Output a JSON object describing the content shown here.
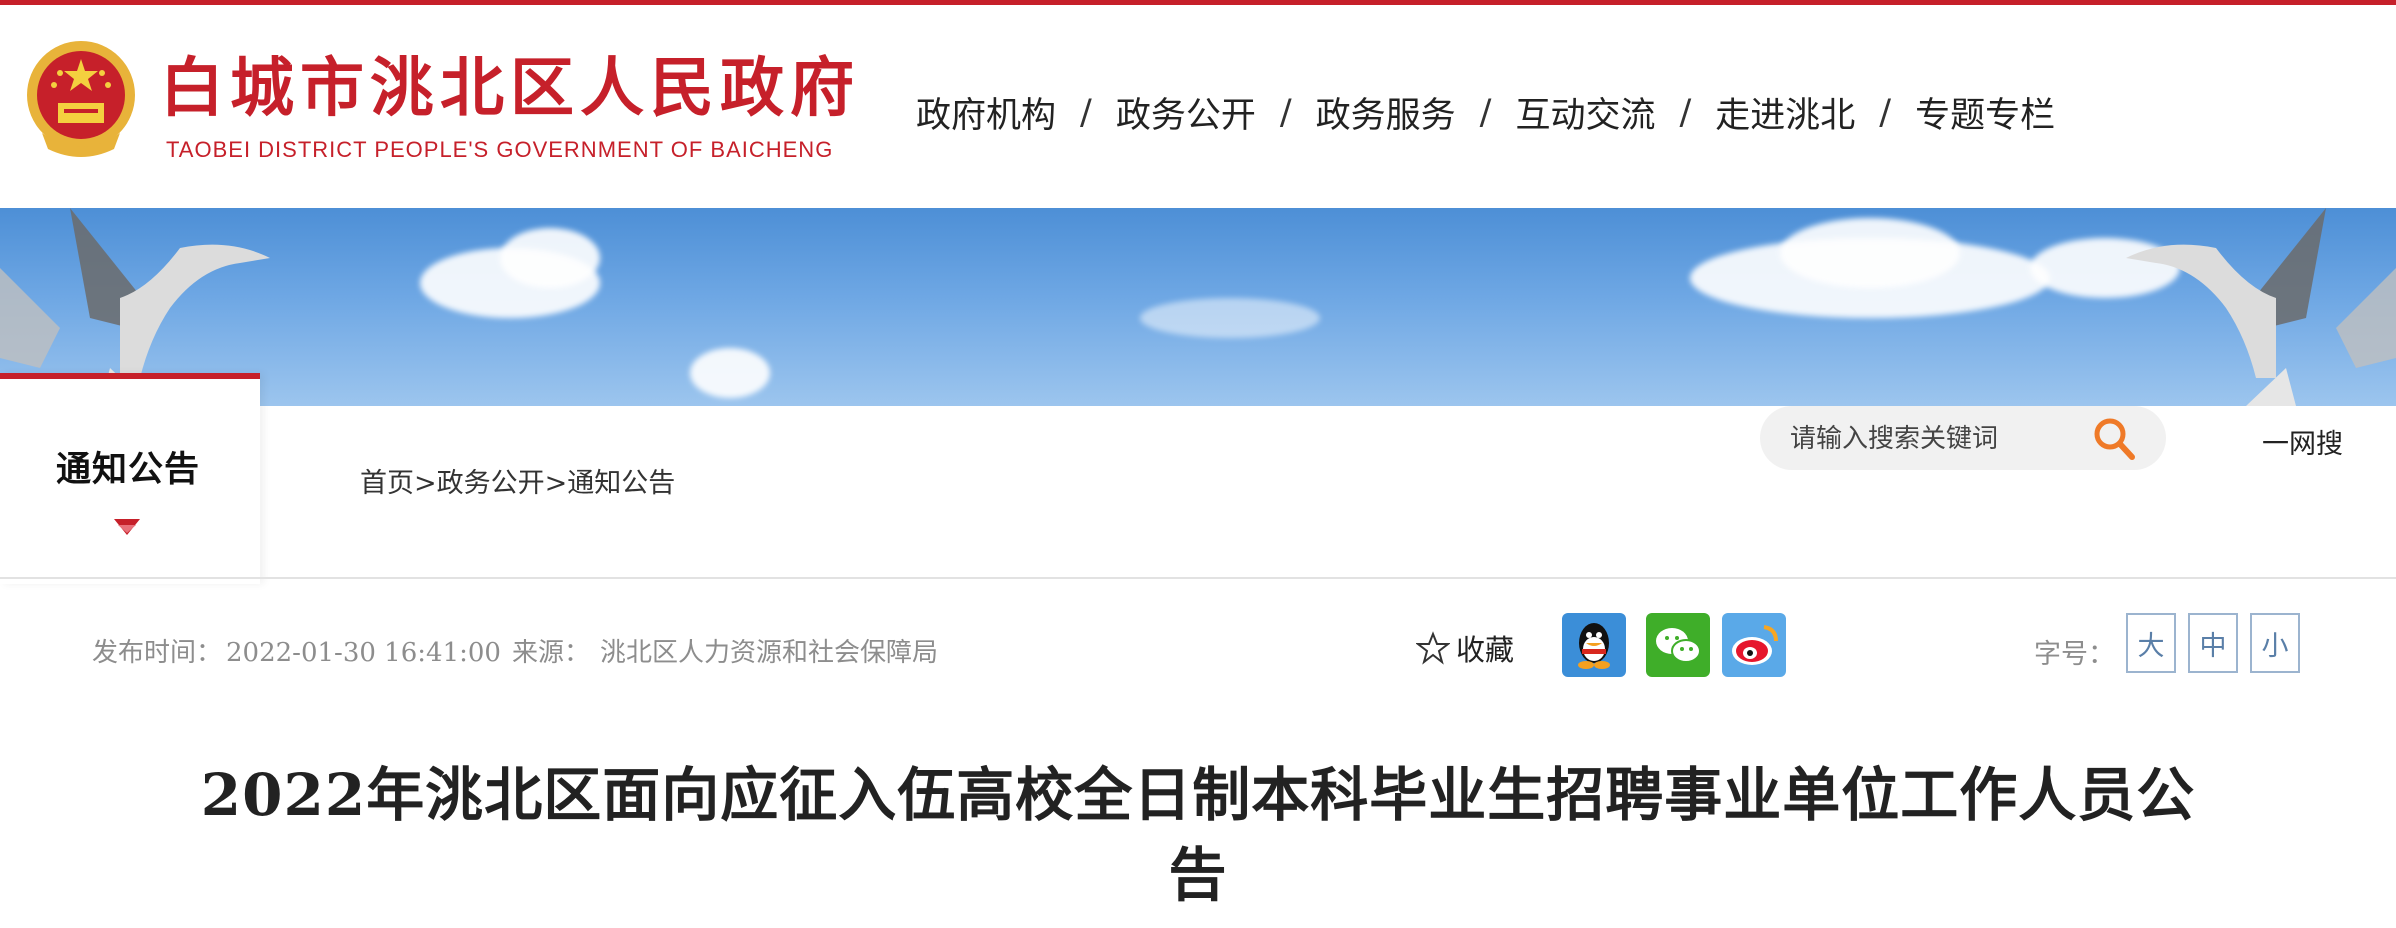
{
  "site": {
    "title": "白城市洮北区人民政府",
    "subtitle": "TAOBEI DISTRICT PEOPLE'S GOVERNMENT OF BAICHENG",
    "emblem_icon": "national-emblem-icon"
  },
  "nav": {
    "items": [
      "政府机构",
      "政务公开",
      "政务服务",
      "互动交流",
      "走进洮北",
      "专题专栏"
    ],
    "separator": "/"
  },
  "column": {
    "title": "通知公告"
  },
  "breadcrumb": {
    "items": [
      "首页",
      "政务公开",
      "通知公告"
    ],
    "separator": ">"
  },
  "search": {
    "placeholder": "请输入搜索关键词",
    "yiwang": "一网搜"
  },
  "meta": {
    "publish_label": "发布时间：",
    "publish_time": "2022-01-30 16:41:00",
    "source_label": "来源：",
    "source": "洮北区人力资源和社会保障局",
    "favorite": "收藏",
    "share_icons": [
      "qq-icon",
      "wechat-icon",
      "weibo-icon"
    ],
    "fontsize_label": "字号：",
    "fontsize_options": [
      "大",
      "中",
      "小"
    ]
  },
  "article": {
    "title": "2022年洮北区面向应征入伍高校全日制本科毕业生招聘事业单位工作人员公告"
  },
  "colors": {
    "brand_red": "#c6202a",
    "banner_blue": "#6ea7e4",
    "fontsize_border": "#9cb4cf"
  }
}
